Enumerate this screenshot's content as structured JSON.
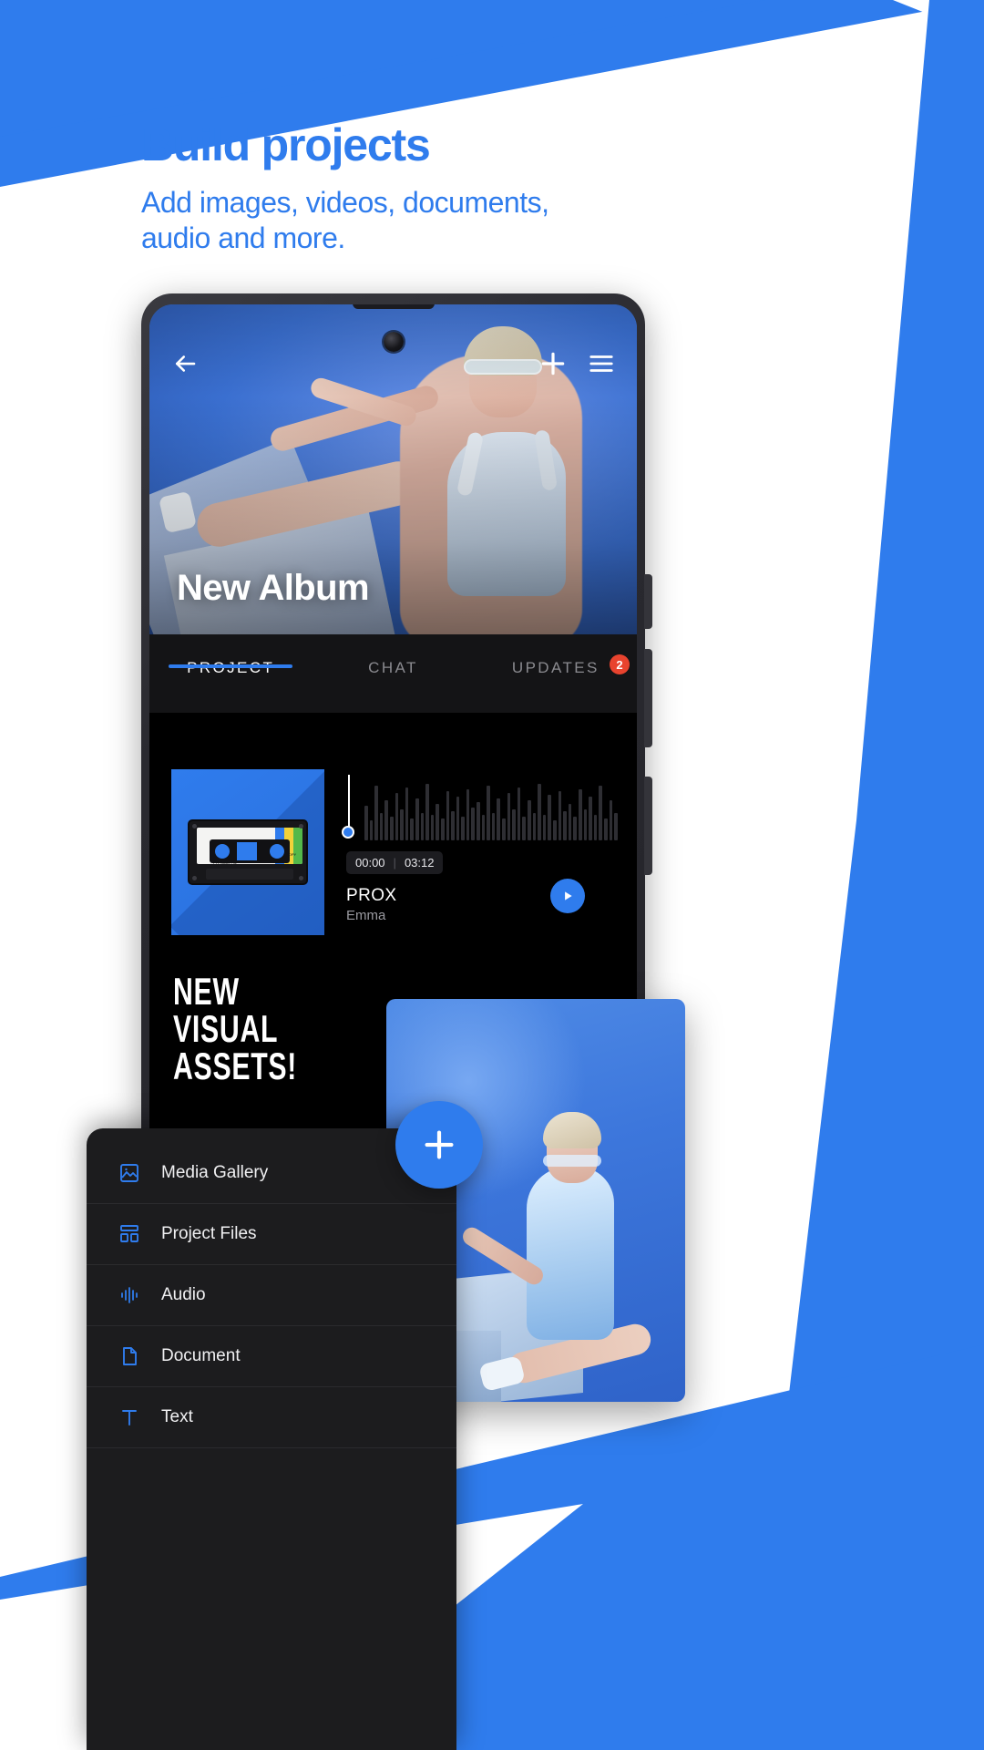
{
  "promo": {
    "headline": "Build projects",
    "subhead_line1": "Add images, videos, documents,",
    "subhead_line2": "audio and more.",
    "accent_color": "#2f7ced"
  },
  "phone": {
    "hero": {
      "title": "New Album",
      "back_icon": "arrow-left-icon",
      "add_icon": "plus-icon",
      "menu_icon": "hamburger-menu-icon"
    },
    "tabs": [
      {
        "label": "PROJECT",
        "active": true,
        "badge": ""
      },
      {
        "label": "CHAT",
        "active": false,
        "badge": ""
      },
      {
        "label": "UPDATES",
        "active": false,
        "badge": "2"
      }
    ],
    "audio_card": {
      "thumbnail_label": "cassette-tape-artwork",
      "cassette_caption": "FOR YOUR INSPIRATION / DEMO COPY",
      "cassette_footer": "FYI: Audio File",
      "cassette_code": "B100",
      "current_time": "00:00",
      "total_time": "03:12",
      "time_separator": "|",
      "track_title": "PROX",
      "track_artist": "Emma",
      "play_icon": "play-icon"
    },
    "promo_text": {
      "line1": "NEW",
      "line2": "VISUAL",
      "line3": "ASSETS!"
    }
  },
  "fab": {
    "icon": "plus-icon",
    "color": "#2f7ced"
  },
  "menu": {
    "items": [
      {
        "label": "Media Gallery",
        "icon": "image-icon"
      },
      {
        "label": "Project Files",
        "icon": "grid-files-icon"
      },
      {
        "label": "Audio",
        "icon": "audio-waveform-icon"
      },
      {
        "label": "Document",
        "icon": "document-icon"
      },
      {
        "label": "Text",
        "icon": "text-icon"
      }
    ]
  }
}
